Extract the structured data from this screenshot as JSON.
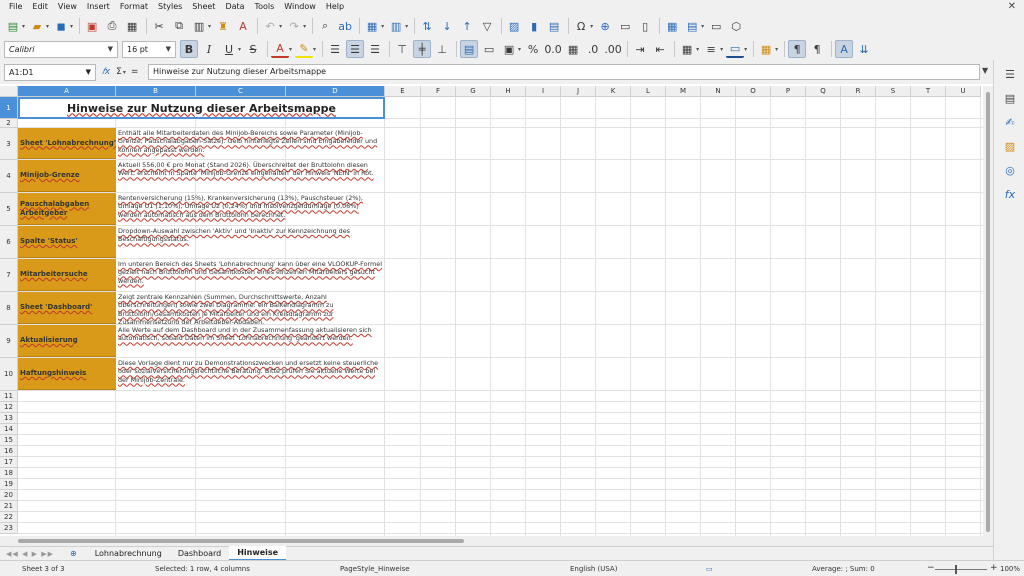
{
  "menu": [
    "File",
    "Edit",
    "View",
    "Insert",
    "Format",
    "Styles",
    "Sheet",
    "Data",
    "Tools",
    "Window",
    "Help"
  ],
  "font": {
    "name": "Calibri",
    "size": "16 pt"
  },
  "namebox": "A1:D1",
  "formula": "Hinweise zur Nutzung dieser Arbeitsmappe",
  "formula_icons": {
    "fx": "𝑓x",
    "sum": "Σ",
    "eq": "="
  },
  "columns": [
    "A",
    "B",
    "C",
    "D",
    "E",
    "F",
    "G",
    "H",
    "I",
    "J",
    "K",
    "L",
    "M",
    "N",
    "O",
    "P",
    "Q",
    "R",
    "S",
    "T",
    "U"
  ],
  "rows": [
    "1",
    "2",
    "3",
    "4",
    "5",
    "6",
    "7",
    "8",
    "9",
    "10",
    "11",
    "12",
    "13",
    "14",
    "15",
    "16",
    "17",
    "18",
    "19",
    "20",
    "21",
    "22",
    "23"
  ],
  "title": "Hinweise zur Nutzung dieser Arbeitsmappe",
  "entries": [
    {
      "label": "Sheet 'Lohnabrechnung'",
      "text": "Enthält alle Mitarbeiterdaten des Minijob-Bereichs sowie Parameter (Minijob-Grenze, Pauschalabgaben-Sätze). Gelb hinterlegte Zellen sind Eingabefelder und können angepasst werden."
    },
    {
      "label": "Minijob-Grenze",
      "text": "Aktuell 556,00 € pro Monat (Stand 2026). Überschreitet der Bruttolohn diesen Wert, erscheint in Spalte 'Minijob-Grenze eingehalten' der Hinweis 'NEIN' in Rot."
    },
    {
      "label": "Pauschalabgaben Arbeitgeber",
      "text": "Rentenversicherung (15%), Krankenversicherung (13%), Pauschsteuer (2%), Umlage U1 (1,10%), Umlage U2 (0,24%) und Insolvenzgeldumlage (0,06%) werden automatisch aus dem Bruttolohn berechnet."
    },
    {
      "label": "Spalte 'Status'",
      "text": "Dropdown-Auswahl zwischen 'Aktiv' und 'Inaktiv' zur Kennzeichnung des Beschäftigungsstatus."
    },
    {
      "label": "Mitarbeitersuche",
      "text": "Im unteren Bereich des Sheets 'Lohnabrechnung' kann über eine VLOOKUP-Formel gezielt nach Bruttolohn und Gesamtkosten eines einzelnen Mitarbeiters gesucht werden."
    },
    {
      "label": "Sheet 'Dashboard'",
      "text": "Zeigt zentrale Kennzahlen (Summen, Durchschnittswerte, Anzahl Überschreitungen) sowie zwei Diagramme: ein Balkendiagramm zu Bruttolohn/Gesamtkosten je Mitarbeiter und ein Kreisdiagramm zur Zusammensetzung der Arbeitgeber-Abgaben."
    },
    {
      "label": "Aktualisierung",
      "text": "Alle Werte auf dem Dashboard und in der Zusammenfassung aktualisieren sich automatisch, sobald Daten im Sheet 'Lohnabrechnung' geändert werden."
    },
    {
      "label": "Haftungshinweis",
      "text": "Diese Vorlage dient nur zu Demonstrationszwecken und ersetzt keine steuerliche oder sozialversicherungsrechtliche Beratung. Bitte prüfen Sie aktuelle Werte bei der Minijob-Zentrale."
    }
  ],
  "tabs": [
    "Lohnabrechnung",
    "Dashboard",
    "Hinweise"
  ],
  "active_tab": "Hinweise",
  "status": {
    "sheet": "Sheet 3 of 3",
    "selection": "Selected: 1 row, 4 columns",
    "pagestyle": "PageStyle_Hinweise",
    "language": "English (USA)",
    "summary": "Average: ; Sum: 0",
    "zoom": "100%"
  },
  "colors": {
    "label_bg": "#d89a18",
    "selection": "#4a90d9",
    "chrome": "#f0f0f0"
  }
}
